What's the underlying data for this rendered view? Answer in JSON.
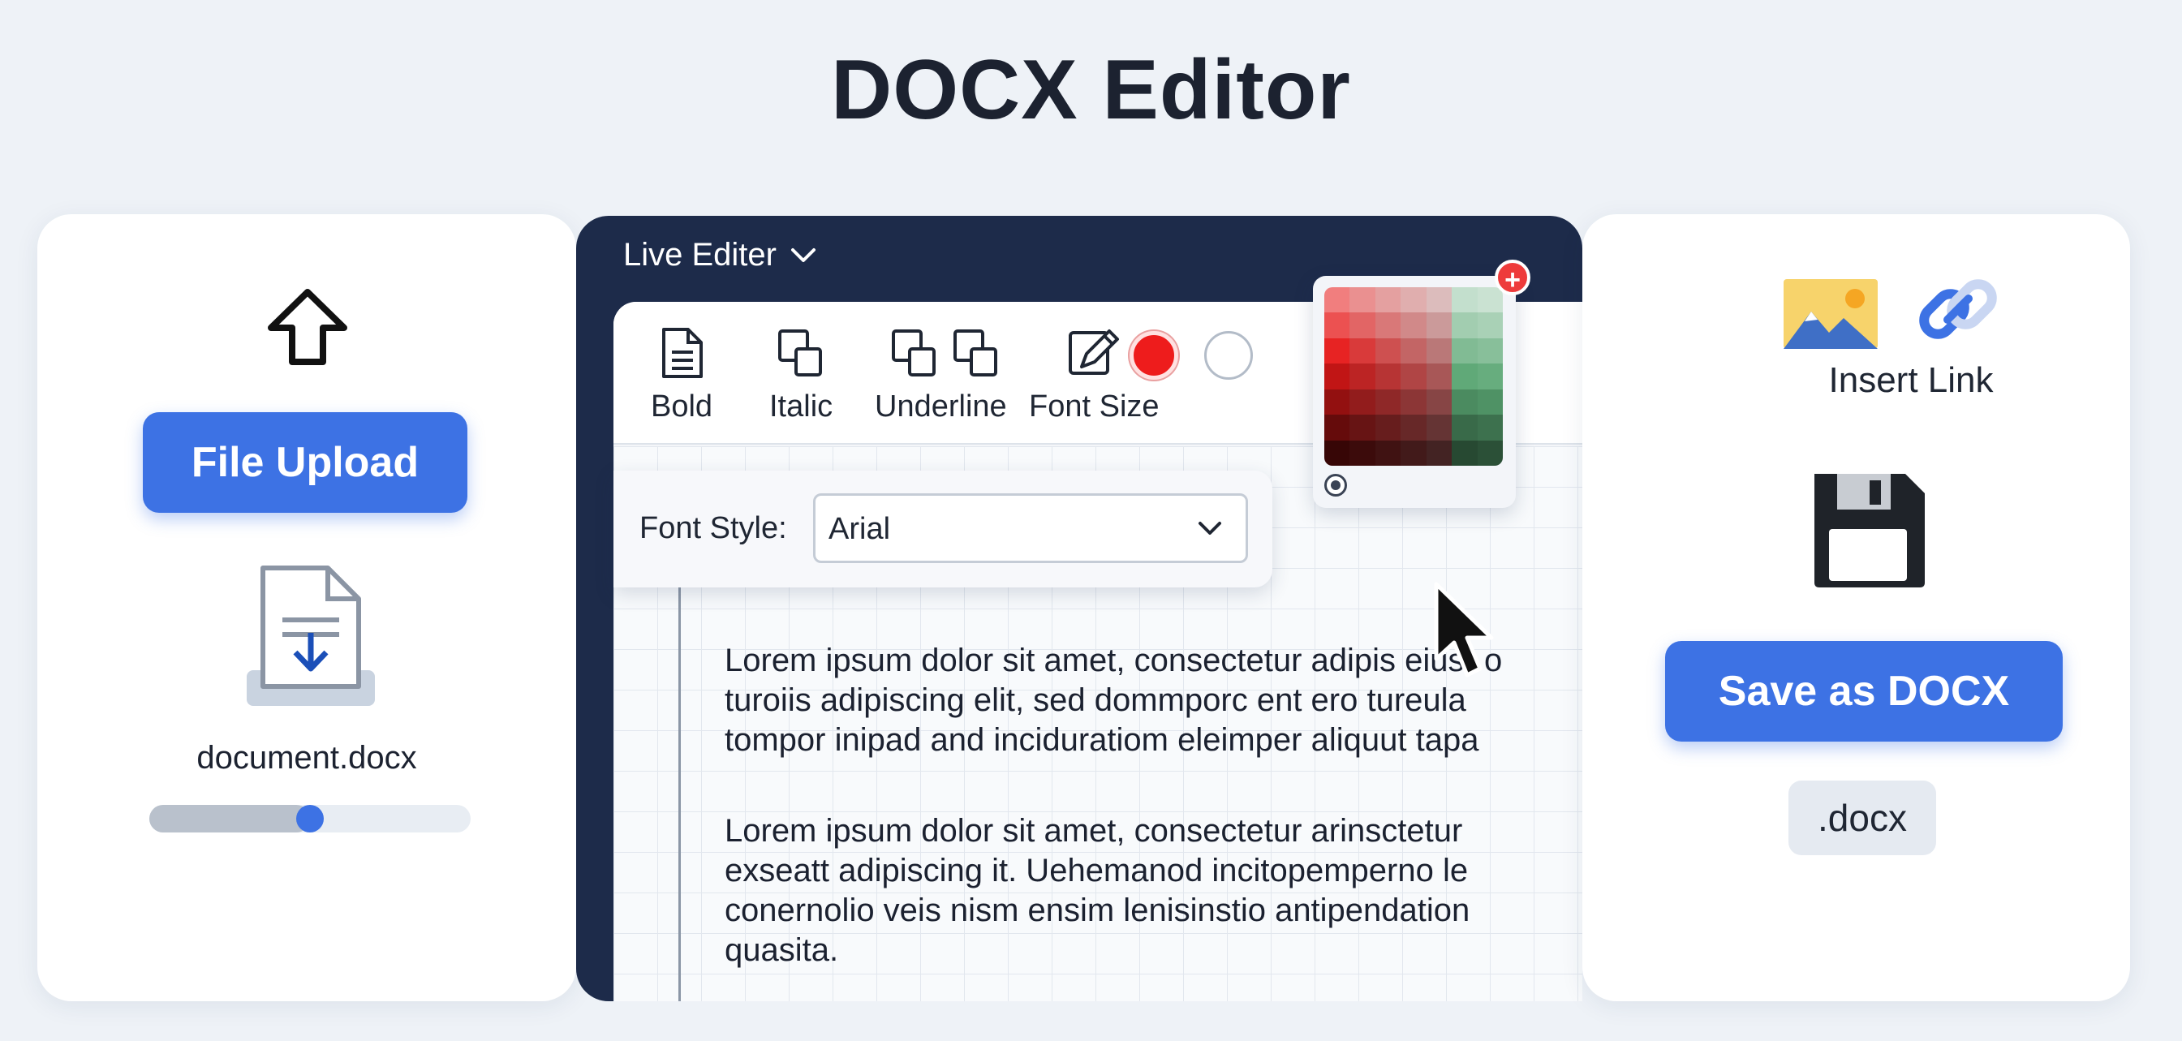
{
  "page": {
    "title": "DOCX Editor"
  },
  "upload_panel": {
    "upload_button": "File Upload",
    "file_name": "document.docx",
    "upload_progress": 0.5,
    "upload_icon": "upload-arrow-icon",
    "file_icon": "docx-download-file-icon"
  },
  "editor": {
    "header_title": "Live Editer",
    "toolbar": {
      "tools": [
        {
          "label": "Bold",
          "icon": "document-icon"
        },
        {
          "label": "Italic",
          "icon": "squares-icon"
        },
        {
          "label": "Underline",
          "icon": "squares-icon"
        },
        {
          "label": "Font Size",
          "icon": "edit-icon"
        }
      ],
      "selected_color": "#ee1c1c",
      "alt_color": "#ffffff"
    },
    "font_style": {
      "label": "Font Style:",
      "value": "Arial"
    },
    "color_picker": {
      "add_label": "+"
    },
    "document": {
      "paragraph1": [
        "Lorem ipsum dolor sit amet, consectetur adipis eiusr o",
        "turoiis adipiscing elit, sed dommporc ent ero tureula",
        "tompor inipad and inciduratiom eleimper aliquut tapa"
      ],
      "paragraph2": [
        "Lorem ipsum dolor sit amet, consectetur arinsctetur",
        "exseatt adipiscing it. Uehemanod incitopemperno le",
        "conernolio veis nism ensim lenisinstio antipendation",
        "quasita."
      ]
    }
  },
  "actions_panel": {
    "insert_link_label": "Insert Link",
    "save_button": "Save as DOCX",
    "file_extension": ".docx",
    "image_icon": "image-icon",
    "link_icon": "link-icon",
    "save_icon": "floppy-disk-icon"
  },
  "colors": {
    "accent": "#3d72e4",
    "editor_frame": "#1d2b4a",
    "background": "#eef2f7"
  }
}
